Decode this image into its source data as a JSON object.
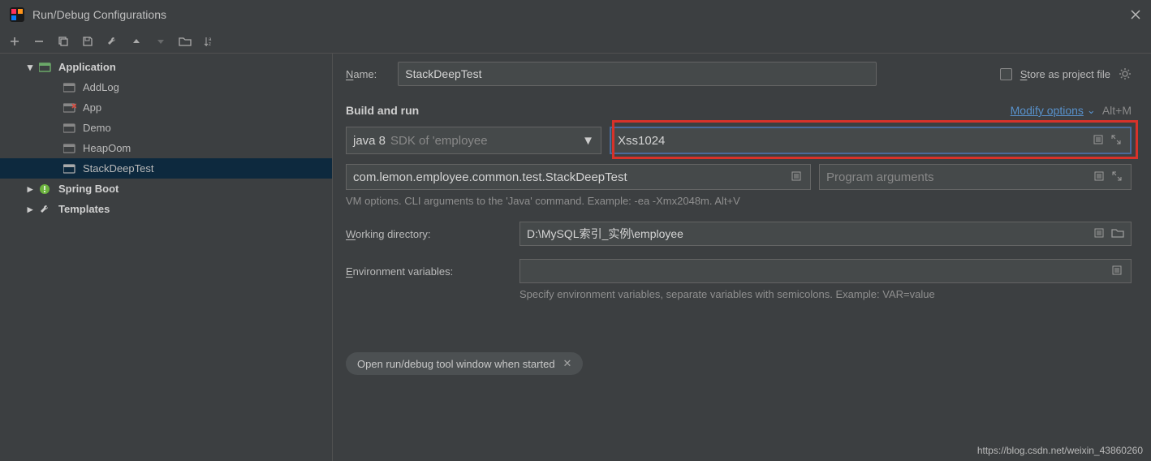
{
  "window": {
    "title": "Run/Debug Configurations"
  },
  "tree": {
    "application": "Application",
    "items": [
      "AddLog",
      "App",
      "Demo",
      "HeapOom",
      "StackDeepTest"
    ],
    "spring": "Spring Boot",
    "templates": "Templates"
  },
  "form": {
    "name_label": "Name:",
    "name_value": "StackDeepTest",
    "store_label": "Store as project file",
    "section": "Build and run",
    "modify": "Modify options",
    "modify_shortcut": "Alt+M",
    "jdk_main": "java 8",
    "jdk_sub": "SDK of 'employee",
    "vm_value": "Xss1024",
    "main_class": "com.lemon.employee.common.test.StackDeepTest",
    "prog_placeholder": "Program arguments",
    "vm_hint": "VM options. CLI arguments to the 'Java' command. Example: -ea -Xmx2048m. Alt+V",
    "wd_label": "Working directory:",
    "wd_value": "D:\\MySQL索引_实例\\employee",
    "env_label": "Environment variables:",
    "env_hint": "Specify environment variables, separate variables with semicolons. Example: VAR=value",
    "chip": "Open run/debug tool window when started"
  },
  "watermark": "https://blog.csdn.net/weixin_43860260"
}
